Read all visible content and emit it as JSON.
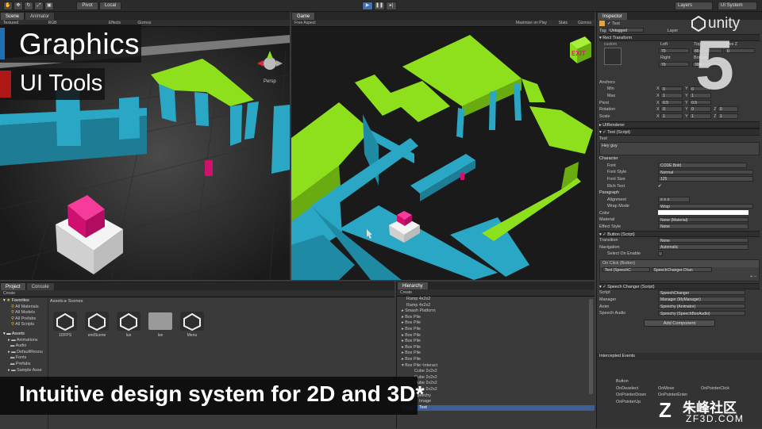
{
  "toolbar": {
    "pivot": "Pivot",
    "local": "Local",
    "layers": "Layers",
    "layout": "UI System"
  },
  "scene": {
    "tab_scene": "Scene",
    "tab_animator": "Animator",
    "shading": "Textured",
    "rgb": "RGB",
    "effects": "Effects",
    "gizmos": "Gizmos",
    "persp": "Persp"
  },
  "game": {
    "tab": "Game",
    "aspect": "Free Aspect",
    "maximize": "Maximize on Play",
    "stats": "Stats",
    "gizmos": "Gizmos",
    "exit": "EXIT"
  },
  "overlay": {
    "title": "Graphics",
    "subtitle": "UI Tools",
    "caption": "Intuitive design system for 2D and 3D*",
    "brand": "unity",
    "version": "5",
    "watermark_cn": "朱峰社区",
    "watermark_url": "ZF3D.COM"
  },
  "inspector": {
    "tab": "Inspector",
    "object_name": "Text",
    "tag_label": "Tag",
    "tag_value": "Untagged",
    "layer_label": "Layer",
    "rect_transform": "Rect Transform",
    "custom": "custom",
    "left": "Left",
    "top": "Top",
    "pos_z": "Pos Z",
    "left_v": "70",
    "top_v": "80",
    "posz_v": "0",
    "right": "Right",
    "bottom": "Bottom",
    "right_v": "70",
    "bottom_v": "300",
    "anchors": "Anchors",
    "min": "Min",
    "max": "Max",
    "min_x": "0",
    "min_y": "0",
    "max_x": "1",
    "max_y": "1",
    "pivot": "Pivot",
    "pivot_x": "0.5",
    "pivot_y": "0.5",
    "rotation": "Rotation",
    "rot_x": "0",
    "rot_y": "0",
    "rot_z": "0",
    "scale": "Scale",
    "scl_x": "1",
    "scl_y": "1",
    "scl_z": "1",
    "ui_renderer": "UIRenderer",
    "text_script": "Text (Script)",
    "text_label": "Text",
    "text_value": "Hey guy",
    "character": "Character",
    "font": "Font",
    "font_v": "CODE Bold",
    "font_style": "Font Style",
    "font_style_v": "Normal",
    "font_size": "Font Size",
    "font_size_v": "125",
    "rich_text": "Rich Text",
    "paragraph": "Paragraph",
    "alignment": "Alignment",
    "wrap_mode": "Wrap Mode",
    "wrap_mode_v": "Wrap",
    "color": "Color",
    "material": "Material",
    "material_v": "None (Material)",
    "effect_style": "Effect Style",
    "effect_style_v": "None",
    "button_script": "Button (Script)",
    "transition": "Transition",
    "transition_v": "None",
    "navigation": "Navigation",
    "navigation_v": "Automatic",
    "select_on_enable": "Select On Enable",
    "on_click": "On Click (Button)",
    "on_click_target": "Text (SpeechC",
    "on_click_method": "SpeechChanger.Chan",
    "speech_changer": "Speech Changer (Script)",
    "script": "Script",
    "script_v": "SpeechChanger",
    "manager": "Manager",
    "manager_v": "Manager (MyManager)",
    "anim": "Anim",
    "anim_v": "Speechy (Animator)",
    "speech_audio": "Speech Audio",
    "speech_audio_v": "Speechy (SpeechBoxAudio)",
    "add_component": "Add Component"
  },
  "events": {
    "title": "Intercepted Events",
    "col1_head": "Button",
    "col1": [
      "OnDeselect",
      "OnPointerDown",
      "OnPointerUp"
    ],
    "col2": [
      "OnMove",
      "OnPointerEnter"
    ],
    "col3": [
      "OnPointerClick"
    ]
  },
  "project": {
    "tab_project": "Project",
    "tab_console": "Console",
    "create": "Create",
    "favorites": "Favorites",
    "fav_items": [
      "All Materials",
      "All Models",
      "All Prefabs",
      "All Scripts"
    ],
    "assets": "Assets",
    "asset_items": [
      "Animations",
      "Audio",
      "DefaultResou",
      "Fonts",
      "Prefabs",
      "Sample Asse"
    ],
    "breadcrumb_assets": "Assets",
    "breadcrumb_scenes": "Scenes",
    "files": [
      "1DFPS",
      "endScene",
      "lus",
      "Ise",
      "Menu"
    ]
  },
  "hierarchy": {
    "tab": "Hierarchy",
    "create": "Create",
    "items": [
      "Ramp 4x2x2",
      "Ramp 4x2x2",
      "Smash Platform",
      "Box Pile",
      "Box Pile",
      "Box Pile",
      "Box Pile",
      "Box Pile",
      "Box Pile",
      "Box Pile",
      "Box Pile",
      "Box Pile~Interact",
      "Cube 2x2x2",
      "Cube 2x2x2",
      "Cube 2x2x2",
      "Cube 2x2x2",
      "Speechy",
      "Image",
      "Text"
    ]
  },
  "colors": {
    "green": "#8ee01c",
    "cyan": "#2aa7c4",
    "magenta": "#e0157a",
    "selection": "#3e5f96"
  }
}
